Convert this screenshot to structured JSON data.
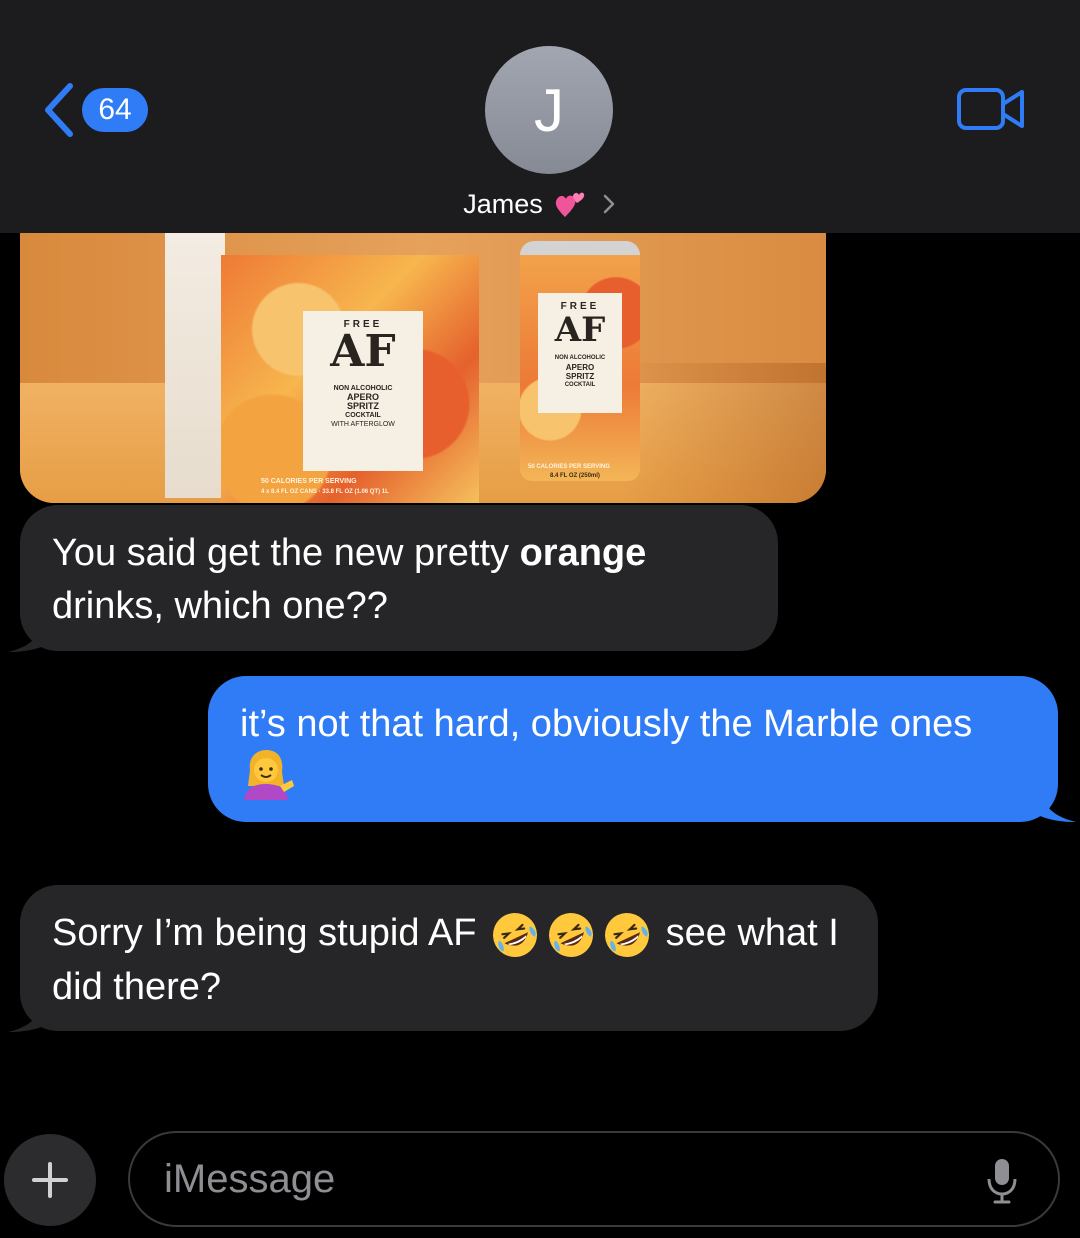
{
  "header": {
    "back_badge": "64",
    "avatar_initial": "J",
    "contact_name": "James",
    "icons": [
      "chevron-left-icon",
      "two-hearts-icon",
      "chevron-right-icon",
      "video-camera-icon"
    ]
  },
  "image_message": {
    "box_label": {
      "free": "FREE",
      "af": "AF",
      "line1": "NON ALCOHOLIC",
      "line2": "APERO",
      "line3": "SPRITZ",
      "line4": "COCKTAIL",
      "line5": "WITH AFTERGLOW",
      "footer1": "50 CALORIES PER SERVING",
      "footer2": "4 x 8.4 FL OZ CANS · 33.8 FL OZ (1.06 QT) 1L"
    },
    "can_label": {
      "free": "FREE",
      "af": "AF",
      "line1": "NON ALCOHOLIC",
      "line2": "APERO",
      "line3": "SPRITZ",
      "line4": "COCKTAIL",
      "footer1": "50 CALORIES PER SERVING",
      "footer2": "8.4 FL OZ (250ml)"
    }
  },
  "messages": [
    {
      "side": "received",
      "text_a": "You said get the new pretty ",
      "text_bold": "orange",
      "text_b": " drinks, which one??"
    },
    {
      "side": "sent",
      "text": "it’s not that hard, obviously the Marble ones",
      "emoji": "woman-tipping-hand-emoji"
    },
    {
      "side": "received",
      "text_a": "Sorry I’m being stupid AF",
      "emoji": "rolling-on-floor-laughing-emoji",
      "emoji_count": 3,
      "text_b": "see what I did there?"
    }
  ],
  "composer": {
    "placeholder": "iMessage",
    "icons": [
      "plus-icon",
      "microphone-icon"
    ]
  },
  "colors": {
    "header_bg": "#1c1c1e",
    "sent_bubble": "#2f7cf6",
    "received_bubble": "#262628",
    "accent": "#2f7cf6"
  }
}
